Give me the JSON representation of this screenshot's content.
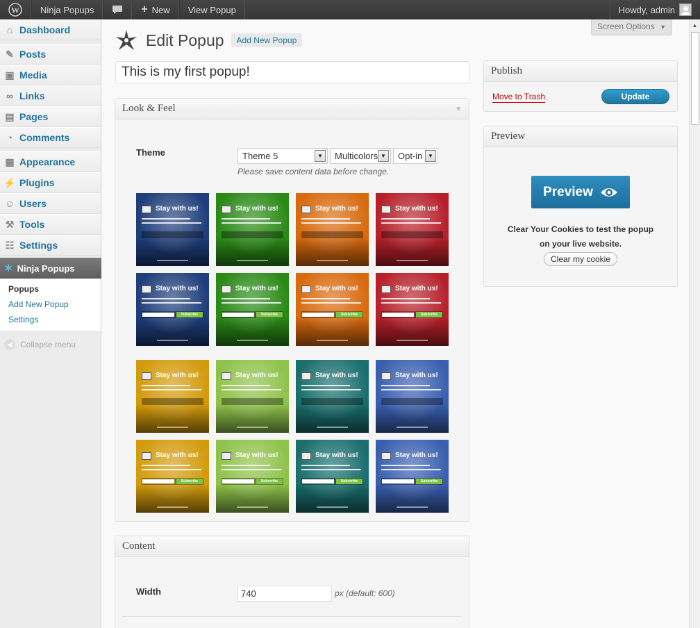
{
  "adminbar": {
    "site_name": "Ninja Popups",
    "new_label": "New",
    "view_label": "View Popup",
    "greeting": "Howdy, admin"
  },
  "sidebar": {
    "items": [
      {
        "label": "Dashboard",
        "icon": "house-icon"
      },
      {
        "label": "Posts",
        "icon": "pin-icon"
      },
      {
        "label": "Media",
        "icon": "media-icon"
      },
      {
        "label": "Links",
        "icon": "link-icon"
      },
      {
        "label": "Pages",
        "icon": "page-icon"
      },
      {
        "label": "Comments",
        "icon": "comment-icon"
      },
      {
        "label": "Appearance",
        "icon": "appearance-icon"
      },
      {
        "label": "Plugins",
        "icon": "plug-icon"
      },
      {
        "label": "Users",
        "icon": "users-icon"
      },
      {
        "label": "Tools",
        "icon": "tools-icon"
      },
      {
        "label": "Settings",
        "icon": "settings-icon"
      }
    ],
    "active": {
      "label": "Ninja Popups",
      "icon": "ninja-star-icon"
    },
    "submenu": [
      "Popups",
      "Add New Popup",
      "Settings"
    ],
    "collapse": "Collapse menu"
  },
  "header": {
    "screen_options": "Screen Options",
    "title": "Edit Popup",
    "add_new": "Add New Popup"
  },
  "post_title": "This is my first popup!",
  "look_feel": {
    "heading": "Look & Feel",
    "theme_label": "Theme",
    "theme_value": "Theme 5",
    "color_value": "Multicolors",
    "type_value": "Opt-in",
    "hint": "Please save content data before change.",
    "thumb_title": "Stay with us!",
    "thumb_button": "Subscribe"
  },
  "content": {
    "heading": "Content",
    "width_label": "Width",
    "width_value": "740",
    "width_hint": "px (default: 600)"
  },
  "publish": {
    "heading": "Publish",
    "trash": "Move to Trash",
    "update": "Update"
  },
  "preview": {
    "heading": "Preview",
    "button": "Preview",
    "line1": "Clear Your Cookies to test the popup",
    "line2": "on your live website.",
    "clear": "Clear my cookie"
  },
  "colors": {
    "link": "#21759b",
    "thumb_backgrounds": [
      "#1e3d7a",
      "#2a8a16",
      "#d86a0e",
      "#b7202a",
      "#1e3d7a",
      "#2a8a16",
      "#d86a0e",
      "#b7202a",
      "#d39b0c",
      "#8fc24a",
      "#1a6e6e",
      "#3a5fb0",
      "#d39b0c",
      "#8fc24a",
      "#1a6e6e",
      "#3a5fb0"
    ]
  }
}
